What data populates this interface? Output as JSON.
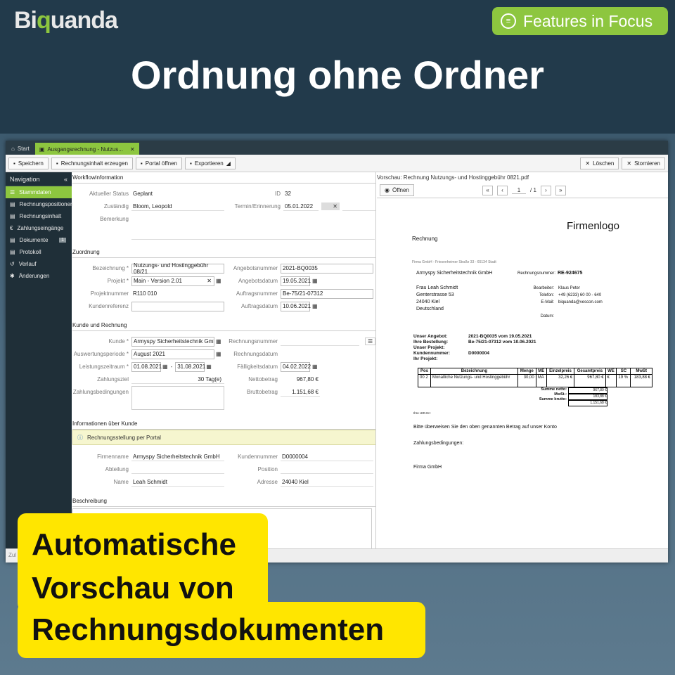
{
  "brand": {
    "logo": "Biquanda",
    "badge": "Features in Focus",
    "headline": "Ordnung ohne Ordner"
  },
  "tabs": [
    {
      "label": "Start"
    },
    {
      "label": "Ausgangsrechnung - Nutzus..."
    }
  ],
  "toolbar": {
    "save": "Speichern",
    "generate": "Rechnungsinhalt erzeugen",
    "portal": "Portal öffnen",
    "export": "Exportieren",
    "delete": "Löschen",
    "cancel": "Stornieren"
  },
  "sidebar": {
    "title": "Navigation",
    "items": [
      {
        "label": "Stammdaten"
      },
      {
        "label": "Rechnungspositionen"
      },
      {
        "label": "Rechnungsinhalt"
      },
      {
        "label": "Zahlungseingänge"
      },
      {
        "label": "Dokumente",
        "count": "1"
      },
      {
        "label": "Protokoll"
      },
      {
        "label": "Verlauf"
      },
      {
        "label": "Änderungen"
      }
    ]
  },
  "workflow": {
    "section": "Workflowinformation",
    "status_label": "Aktueller Status",
    "status": "Geplant",
    "id_label": "ID",
    "id": "32",
    "owner_label": "Zuständig",
    "owner": "Bloom, Leopold",
    "due_label": "Termin/Erinnerung",
    "due": "05.01.2022",
    "note_label": "Bemerkung"
  },
  "assignment": {
    "section": "Zuordnung",
    "name_label": "Bezeichnung *",
    "name": "Nutzungs- und Hostinggebühr 08/21",
    "offer_no_label": "Angebotsnummer",
    "offer_no": "2021-BQ0035",
    "project_label": "Projekt *",
    "project": "Main - Version 2.01",
    "offer_date_label": "Angebotsdatum",
    "offer_date": "19.05.2021",
    "project_no_label": "Projektnummer",
    "project_no": "R110 010",
    "order_no_label": "Auftragsnummer",
    "order_no": "Be-75/21-07312",
    "customer_ref_label": "Kundenreferenz",
    "order_date_label": "Auftragsdatum",
    "order_date": "10.06.2021"
  },
  "billing": {
    "section": "Kunde und Rechnung",
    "customer_label": "Kunde *",
    "customer": "Armyspy Sicherheitstechnik GmbH,",
    "invoice_no_label": "Rechnungsnummer",
    "period_label": "Auswertungsperiode *",
    "period": "August 2021",
    "invoice_date_label": "Rechnungsdatum",
    "service_label": "Leistungszeitraum *",
    "service_from": "01.08.2021",
    "service_to": "31.08.2021",
    "due_date_label": "Fälligkeitsdatum",
    "due_date": "04.02.2022",
    "term_label": "Zahlungsziel",
    "term": "30 Tag(e)",
    "net_label": "Nettobetrag",
    "net": "967,80 €",
    "conditions_label": "Zahlungsbedingungen",
    "gross_label": "Bruttobetrag",
    "gross": "1.151,68 €"
  },
  "customer_info": {
    "section": "Informationen über Kunde",
    "notice": "Rechnungsstellung per Portal",
    "company_label": "Firmenname",
    "company": "Armyspy Sicherheitstechnik GmbH",
    "cust_no_label": "Kundennummer",
    "cust_no": "D0000004",
    "dept_label": "Abteilung",
    "position_label": "Position",
    "name_label": "Name",
    "name": "Leah Schmidt",
    "address_label": "Adresse",
    "address": "24040 Kiel"
  },
  "description": {
    "section": "Beschreibung"
  },
  "statusbar": {
    "text": "Zul"
  },
  "preview": {
    "title": "Vorschau: Rechnung Nutzungs- und Hostinggebühr 0821.pdf",
    "open": "Öffnen",
    "page": "1",
    "pages": "/ 1",
    "doc": {
      "logo": "Firmenlogo",
      "heading": "Rechnung",
      "sender": "Firma GmbH - Friesenheimer Straße 33 - 65134 Stadt",
      "recipient_company": "Armyspy Sicherheitstechnik GmbH",
      "invno_label": "Rechnungsnummer:",
      "invno": "RE-924675",
      "r1": "Frau Leah Schmidt",
      "r2": "Genterstrasse 53",
      "r3": "24040 Kiel",
      "r4": "Deutschland",
      "clerk_label": "Bearbeiter:",
      "clerk": "Klaus Peter",
      "tel_label": "Telefon:",
      "tel": "+49 (6233) 60 00 - 640",
      "mail_label": "E-Mail:",
      "mail": "biquanda@vescon.com",
      "date_label": "Datum:",
      "k1": "Unser Angebot:",
      "v1": "2021-BQ0035 vom 19.05.2021",
      "k2": "Ihre Bestellung:",
      "v2": "Be-75/21-07312 vom 10.06.2021",
      "k3": "Unser Projekt:",
      "k4": "Kundennummer:",
      "v4": "D0000004",
      "k5": "Ihr Projekt:",
      "cols": [
        "Pos",
        "Bezeichnung",
        "Menge",
        "ME",
        "Einzelpreis",
        "Gesamtpreis",
        "WE",
        "SC",
        "MwSt"
      ],
      "row": [
        "00 2",
        "Monatliche Nutzungs- und Hostinggebühr",
        "30,00",
        "MA",
        "32,26 €",
        "967,80 €",
        "€",
        "19 %",
        "183,88 €"
      ],
      "sum_net_label": "Summe netto:",
      "sum_net": "967,80 €",
      "tax_label": "MwSt.:",
      "tax": "183,88 €",
      "sum_gross_label": "Summe brutto:",
      "sum_gross": "1.151,68 €",
      "uid": "Ihre UID-Nr.:",
      "transfer": "Bitte überweisen Sie den oben genannten Betrag auf unser Konto",
      "conditions": "Zahlungsbedingungen:",
      "sign": "Firma GmbH"
    }
  },
  "callout": {
    "line1": "Automatische",
    "line2": "Vorschau von",
    "line3": "Rechnungsdokumenten"
  },
  "colors": {
    "accent": "#8dc63f",
    "dark": "#223a4b",
    "callout": "#ffe600"
  }
}
